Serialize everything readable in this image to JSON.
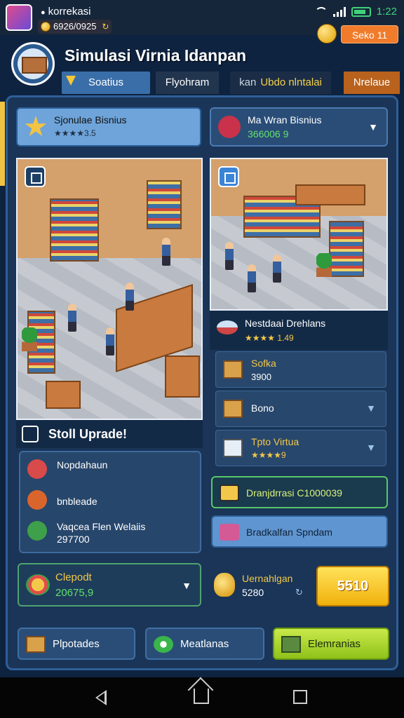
{
  "statusbar": {
    "app_name": "korrekasi",
    "coins": "6926/0925",
    "time": "1:22"
  },
  "topbar": {
    "shop_label": "Seko 11"
  },
  "header": {
    "title": "Simulasi Virnia Idanpan",
    "tabs": [
      {
        "label": "Soatius"
      },
      {
        "label": "Flyohram"
      },
      {
        "prefix": "kan",
        "label": "Ubdo nlntalai"
      },
      {
        "label": "Nrelaue"
      }
    ]
  },
  "business": {
    "current": {
      "name": "Sjonulae Bisnius",
      "rating": "★★★★3.5"
    },
    "other": {
      "name": "Ma Wran Bisnius",
      "value": "366006 9"
    }
  },
  "upgrade": {
    "title": "Stoll  Uprade!",
    "items": [
      {
        "name": "Nopdahaun",
        "value": ""
      },
      {
        "name": "bnbleade",
        "value": ""
      },
      {
        "name": "Vaqcea Flen Welaiis",
        "value": "297700"
      }
    ]
  },
  "right_panel": {
    "header": {
      "name": "Nestdaai Drehlans",
      "rating": "★★★★ 1.49"
    },
    "items": [
      {
        "name": "Sofka",
        "value": "3900"
      },
      {
        "name": "Bono",
        "value": ""
      },
      {
        "name": "Tpto Virtua",
        "value": "★★★★9"
      }
    ],
    "bar_green": "Dranjdrrasi C1000039",
    "bar_blue": "Bradkalfan Spndam"
  },
  "deposit": {
    "label": "Clepodt",
    "value": "20675,9"
  },
  "balance": {
    "label": "Uernahlgan",
    "value": "5280"
  },
  "collect_label": "5510",
  "bottom_nav": {
    "produk": "Plpotades",
    "mekanisme": "Meatlanas",
    "karyawan": "Elemranias"
  },
  "colors": {
    "accent_gold": "#f3c84a",
    "accent_green": "#62e06e",
    "panel": "#1a3557",
    "orange": "#f07b2b"
  }
}
